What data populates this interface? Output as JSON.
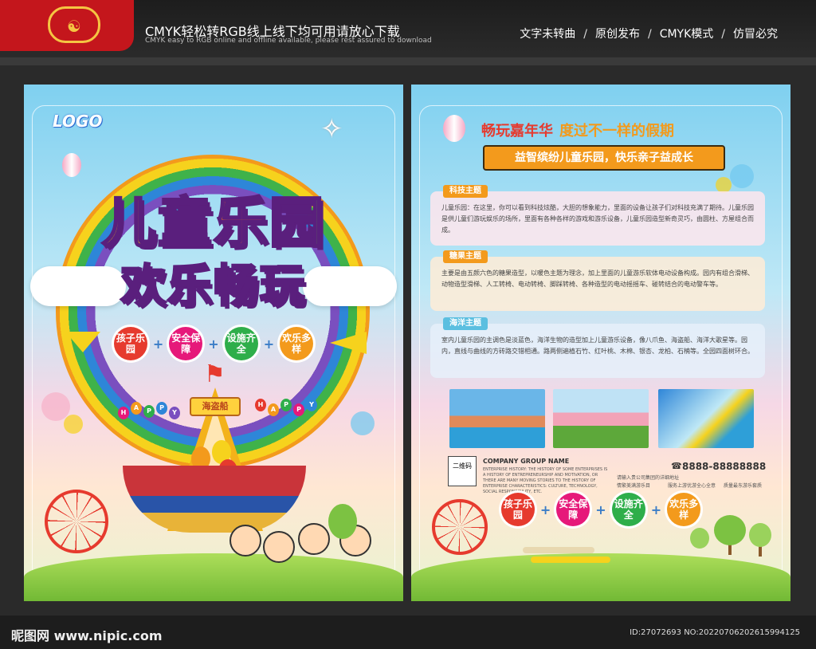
{
  "header": {
    "title": "CMYK轻松转RGB线上线下均可用请放心下载",
    "subtitle": "CMYK easy to RGB online and offline available, please rest assured to download",
    "features": [
      "文字未转曲",
      "原创发布",
      "CMYK模式",
      "仿冒必究"
    ],
    "separator": "/"
  },
  "footer": {
    "site": "昵图网 www.nipic.com",
    "id": "ID:27072693 NO:20220706202615994125"
  },
  "front": {
    "logo": "LOGO",
    "title_chars": [
      "儿",
      "童",
      "乐",
      "园"
    ],
    "subtitle_chars": [
      "欢",
      "乐",
      "畅",
      "玩"
    ],
    "badges": [
      {
        "text": "孩子乐园",
        "color": "#e63a2e"
      },
      {
        "text": "安全保障",
        "color": "#e6197a"
      },
      {
        "text": "设施齐全",
        "color": "#2eae4a"
      },
      {
        "text": "欢乐多样",
        "color": "#f39a1c"
      }
    ],
    "plus": "+",
    "ship_sign": "海盗船",
    "happy_letters": [
      "H",
      "A",
      "P",
      "P",
      "Y"
    ]
  },
  "back": {
    "headline_a": "畅玩嘉年华",
    "headline_b": "度过不一样的假期",
    "banner": "益智缤纷儿童乐园，快乐亲子益成长",
    "sections": [
      {
        "tag": "科技主题",
        "text": "儿童乐园：在这里，你可以看到科技炫酷，大胆的想象能力，里面的设备让孩子们对科技充满了期待。儿童乐园是供儿童们游玩娱乐的场所，里面有各种各样的游戏和游乐设备，儿童乐园造型新奇灵巧，由圆柱、方屋组合而成。"
      },
      {
        "tag": "糖果主题",
        "text": "主要是由五颜六色的糖果造型，以暖色主题为理念，加上里面的儿童游乐软体电动设备构成。园内有组合滑梯、动物造型滑梯、人工转椅、电动转椅、脚踩转椅、各种造型的电动摇摇车、碰转结合的电动警车等。"
      },
      {
        "tag": "海洋主题",
        "text": "室内儿童乐园的主调色是淡蓝色，海洋生物的造型加上儿童游乐设备，像八爪鱼、海盗船、海洋大歌星等。园内，直线与曲线的方砖路交错相通。路两侧遍植石竹、红叶桃、木棉、银杏、龙柏、石楠等。全园四面树环合。"
      }
    ],
    "qr_label": "二维码",
    "company_name": "COMPANY GROUP NAME",
    "company_desc": "ENTERPRISE HISTORY: THE HISTORY OF SOME ENTERPRISES IS A HISTORY OF ENTREPRENEURSHIP AND MOTIVATION, OR THERE ARE MANY MOVING STORIES TO THE HISTORY OF ENTERPRISE CHARACTERISTICS: CULTURE, TECHNOLOGY, SOCIAL RESPONSIBILITY, ETC.",
    "phone": "8888-88888888",
    "info": [
      "请输入贵公司集团的详细地址",
      "情繁美满游乐目",
      "服务上游优游全心全意",
      "质量最东游乐套质"
    ],
    "badges": [
      {
        "text": "孩子乐园",
        "color": "#e63a2e"
      },
      {
        "text": "安全保障",
        "color": "#e6197a"
      },
      {
        "text": "设施齐全",
        "color": "#2eae4a"
      },
      {
        "text": "欢乐多样",
        "color": "#f39a1c"
      }
    ],
    "plus": "+"
  },
  "colors": {
    "red": "#c4161c",
    "gold": "#f5c542",
    "orange": "#f39a1c",
    "bg": "#2a2a2a"
  }
}
